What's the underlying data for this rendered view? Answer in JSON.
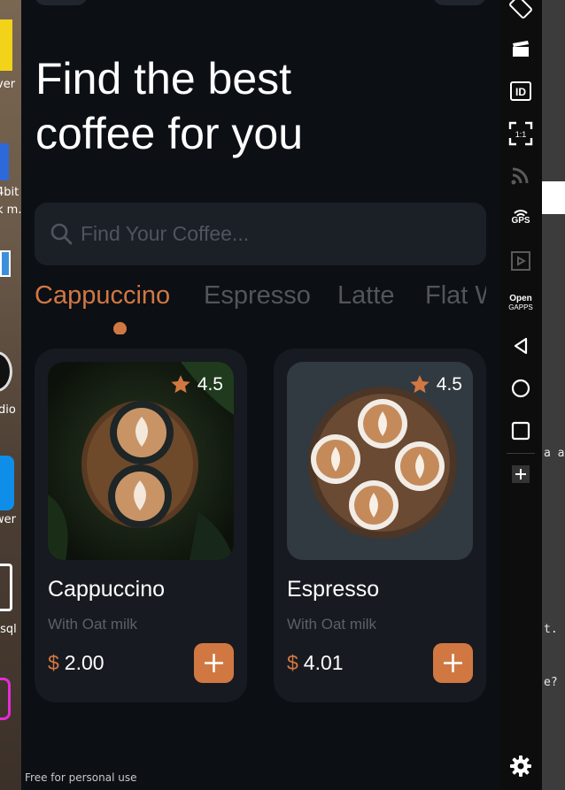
{
  "desktop": {
    "labels": [
      "ver",
      "4bit",
      "k m..",
      "dio",
      "wer",
      ".sql"
    ]
  },
  "app": {
    "headline_line1": "Find the best",
    "headline_line2": "coffee for you",
    "search_placeholder": "Find Your Coffee...",
    "tabs": [
      {
        "label": "Cappuccino",
        "active": true
      },
      {
        "label": "Espresso",
        "active": false
      },
      {
        "label": "Latte",
        "active": false
      },
      {
        "label": "Flat White",
        "active": false
      }
    ],
    "cards": [
      {
        "name": "Cappuccino",
        "subtitle": "With Oat milk",
        "currency": "$",
        "price": "2.00",
        "rating": "4.5"
      },
      {
        "name": "Espresso",
        "subtitle": "With Oat milk",
        "currency": "$",
        "price": "4.01",
        "rating": "4.5"
      }
    ],
    "watermark": "Free for personal use"
  },
  "emulator_toolbar": {
    "items": [
      "rotate-icon",
      "clapperboard-icon",
      "id-icon",
      "pixel-perfect-icon",
      "cast-icon",
      "gps-icon",
      "media-icon",
      "open-gapps-icon",
      "back-icon",
      "home-icon",
      "recents-icon",
      "add-icon",
      "settings-icon"
    ],
    "gps_label": "GPS",
    "pixel_label": "1:1",
    "id_label": "ID",
    "gapps_label_1": "Open",
    "gapps_label_2": "GAPPS"
  },
  "background_text": {
    "line1": "a a",
    "line2": "t.",
    "line3": "e?"
  },
  "colors": {
    "accent": "#d17842",
    "screen_bg": "#0c0f14",
    "card_bg": "#171a20",
    "search_bg": "#1b1f26"
  }
}
